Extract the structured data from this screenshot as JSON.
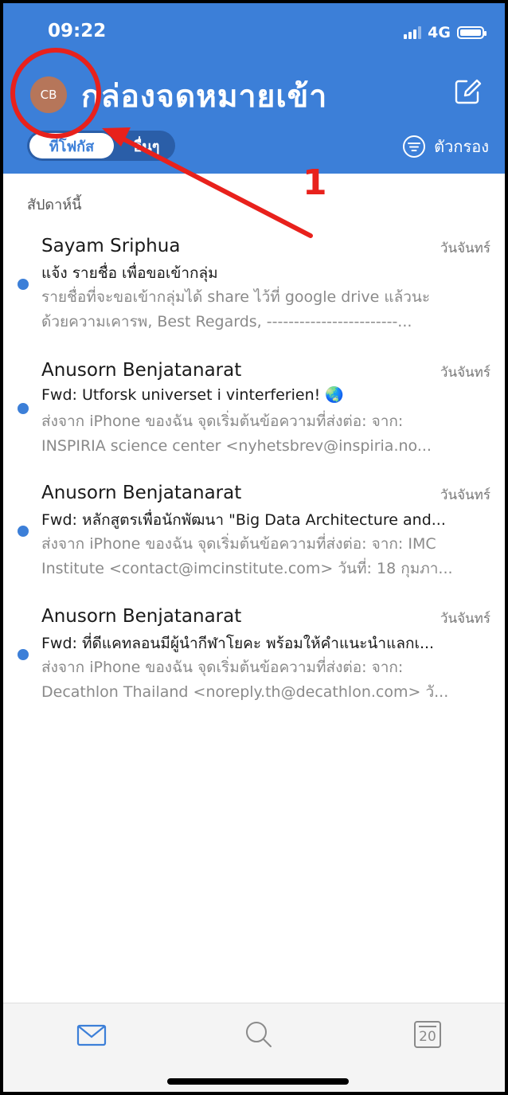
{
  "status_bar": {
    "time": "09:22",
    "network": "4G"
  },
  "header": {
    "avatar_initials": "CB",
    "title": "กล่องจดหมายเข้า",
    "tabs": {
      "focused": "ที่โฟกัส",
      "other": "อื่นๆ"
    },
    "filter_label": "ตัวกรอง"
  },
  "annotation": {
    "number": "1",
    "color": "#e8211c"
  },
  "section_label": "สัปดาห์นี้",
  "emails": [
    {
      "sender": "Sayam Sriphua",
      "date": "วันจันทร์",
      "subject": "แจ้ง รายชื่อ เพื่อขอเข้ากลุ่ม",
      "preview_line1": "รายชื่อที่จะขอเข้ากลุ่มได้ share ไว้ที่ google drive แล้วนะ",
      "preview_line2": "ด้วยความเคารพ, Best Regards, ------------------------...",
      "unread": true
    },
    {
      "sender": "Anusorn Benjatanarat",
      "date": "วันจันทร์",
      "subject": "Fwd: Utforsk universet i vinterferien! 🌏",
      "preview_line1": "ส่งจาก iPhone ของฉัน จุดเริ่มต้นข้อความที่ส่งต่อ: จาก:",
      "preview_line2": "INSPIRIA science center <nyhetsbrev@inspiria.no...",
      "unread": true
    },
    {
      "sender": "Anusorn Benjatanarat",
      "date": "วันจันทร์",
      "subject": "Fwd: หลักสูตรเพื่อนักพัฒนา \"Big Data Architecture and...",
      "preview_line1": "ส่งจาก iPhone ของฉัน จุดเริ่มต้นข้อความที่ส่งต่อ: จาก: IMC",
      "preview_line2": "Institute <contact@imcinstitute.com> วันที่: 18 กุมภา...",
      "unread": true
    },
    {
      "sender": "Anusorn Benjatanarat",
      "date": "วันจันทร์",
      "subject": "Fwd: ที่ดีแคทลอนมีผู้นำกีฬาโยคะ พร้อมให้คำแนะนำแลกเ...",
      "preview_line1": "ส่งจาก iPhone ของฉัน จุดเริ่มต้นข้อความที่ส่งต่อ: จาก:",
      "preview_line2": "Decathlon Thailand <noreply.th@decathlon.com> วั...",
      "unread": true
    }
  ],
  "tabbar": {
    "calendar_day": "20"
  },
  "colors": {
    "accent": "#3c7fd8",
    "annotation": "#e8211c"
  }
}
